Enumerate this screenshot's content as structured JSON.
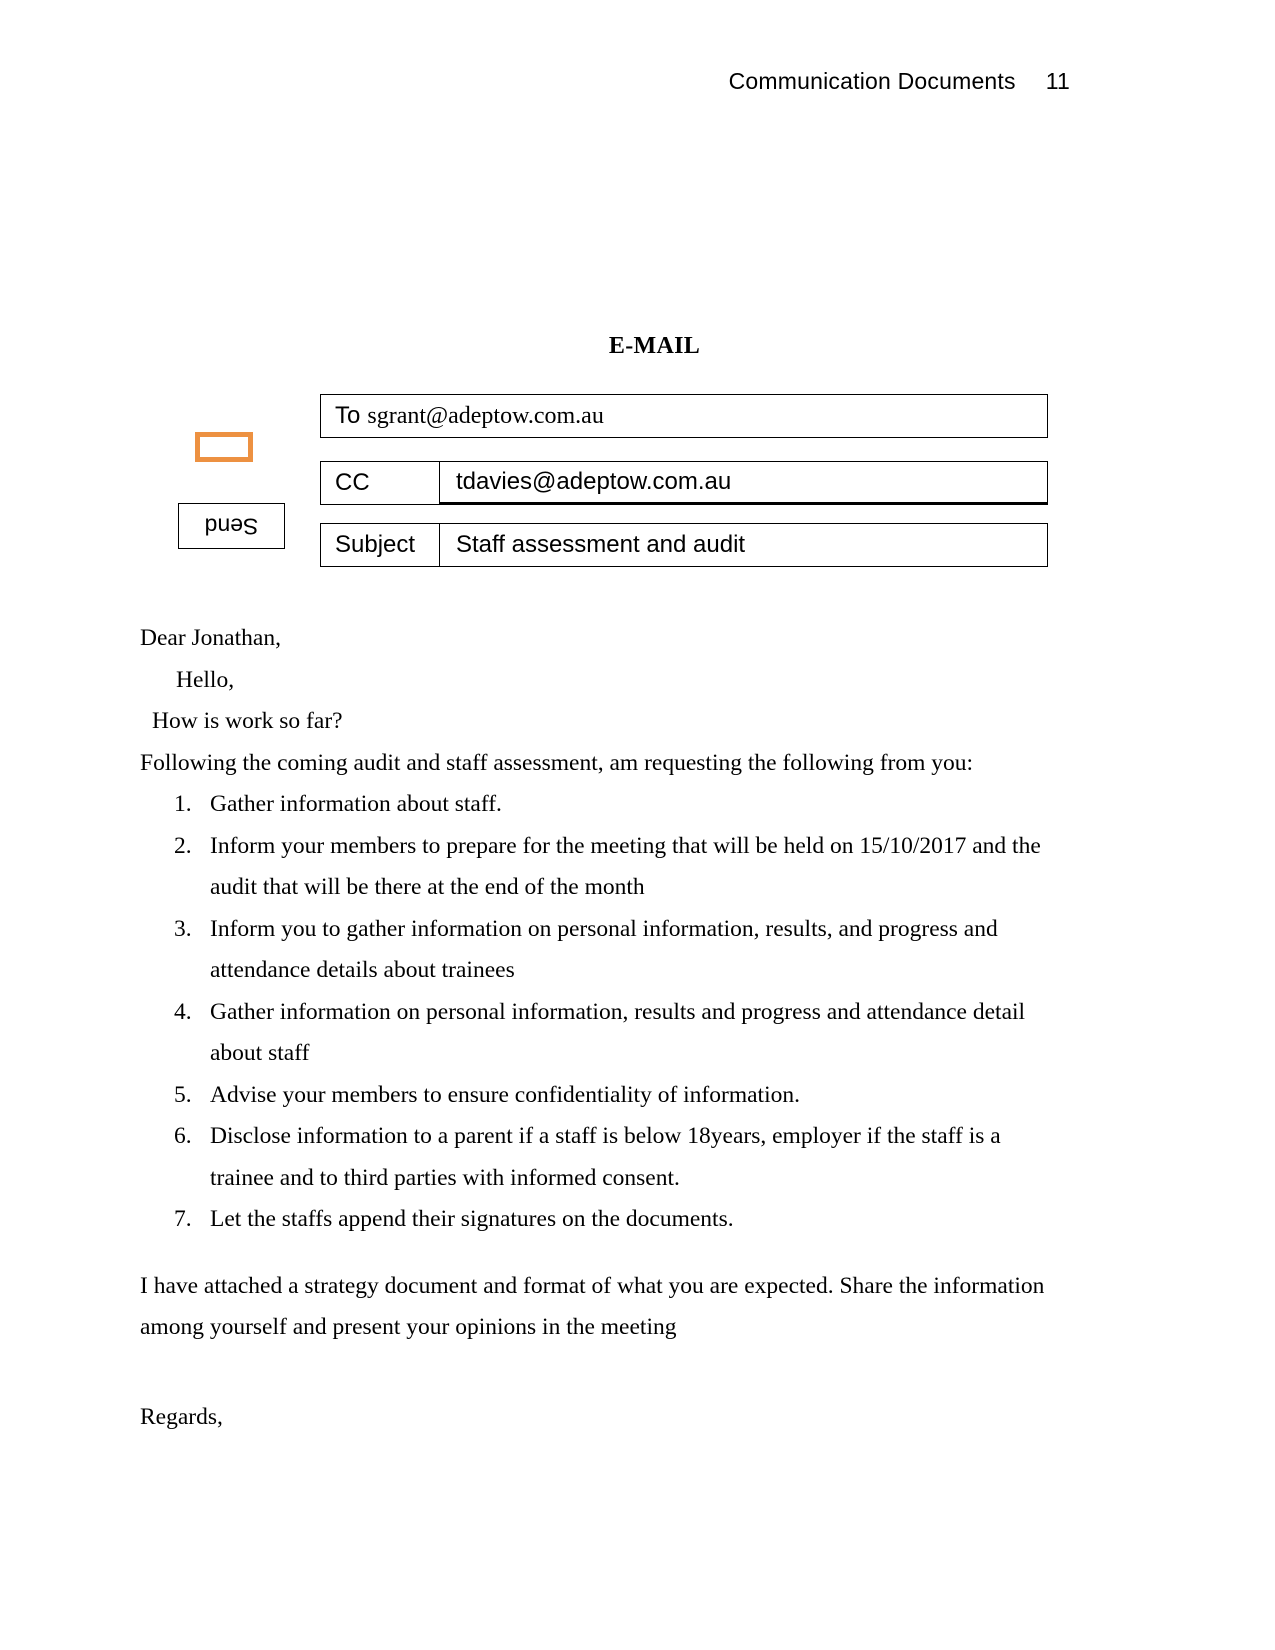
{
  "header": {
    "running_title": "Communication Documents",
    "page_number": "11"
  },
  "document": {
    "title": "E-MAIL"
  },
  "controls": {
    "send_label": "Send",
    "orange_marker_color": "#ED9141"
  },
  "mail_form": {
    "to": {
      "label": "To",
      "value": "sgrant@adeptow.com.au"
    },
    "cc": {
      "label": "CC",
      "value": "tdavies@adeptow.com.au"
    },
    "subject": {
      "label": "Subject",
      "value": "Staff assessment and audit"
    }
  },
  "body": {
    "greeting": "Dear Jonathan,",
    "hello": "Hello,",
    "how_is_work": "How is work so far?",
    "intro": "Following the coming audit and staff assessment, am requesting the following from you:",
    "items": [
      {
        "num": "1.",
        "text": "Gather information about staff."
      },
      {
        "num": "2.",
        "text": "Inform your members to prepare for the meeting that will be held on 15/10/2017 and the audit that will be there at the end of the month"
      },
      {
        "num": "3.",
        "text": "Inform you to gather information on personal information, results, and progress and attendance details about trainees"
      },
      {
        "num": "4.",
        "text": " Gather information on personal information, results and progress and attendance detail about staff"
      },
      {
        "num": "5.",
        "text": "Advise your members to ensure confidentiality of information."
      },
      {
        "num": "6.",
        "text": "Disclose information to a parent if a staff is below 18years, employer if the staff is a trainee and to third parties with informed consent."
      },
      {
        "num": "7.",
        "text": "Let the staffs append their signatures on the documents."
      }
    ],
    "closing_paragraph": "I have attached a strategy document and format of what you are expected. Share the information among yourself and present your opinions in the meeting",
    "regards": "Regards,"
  }
}
